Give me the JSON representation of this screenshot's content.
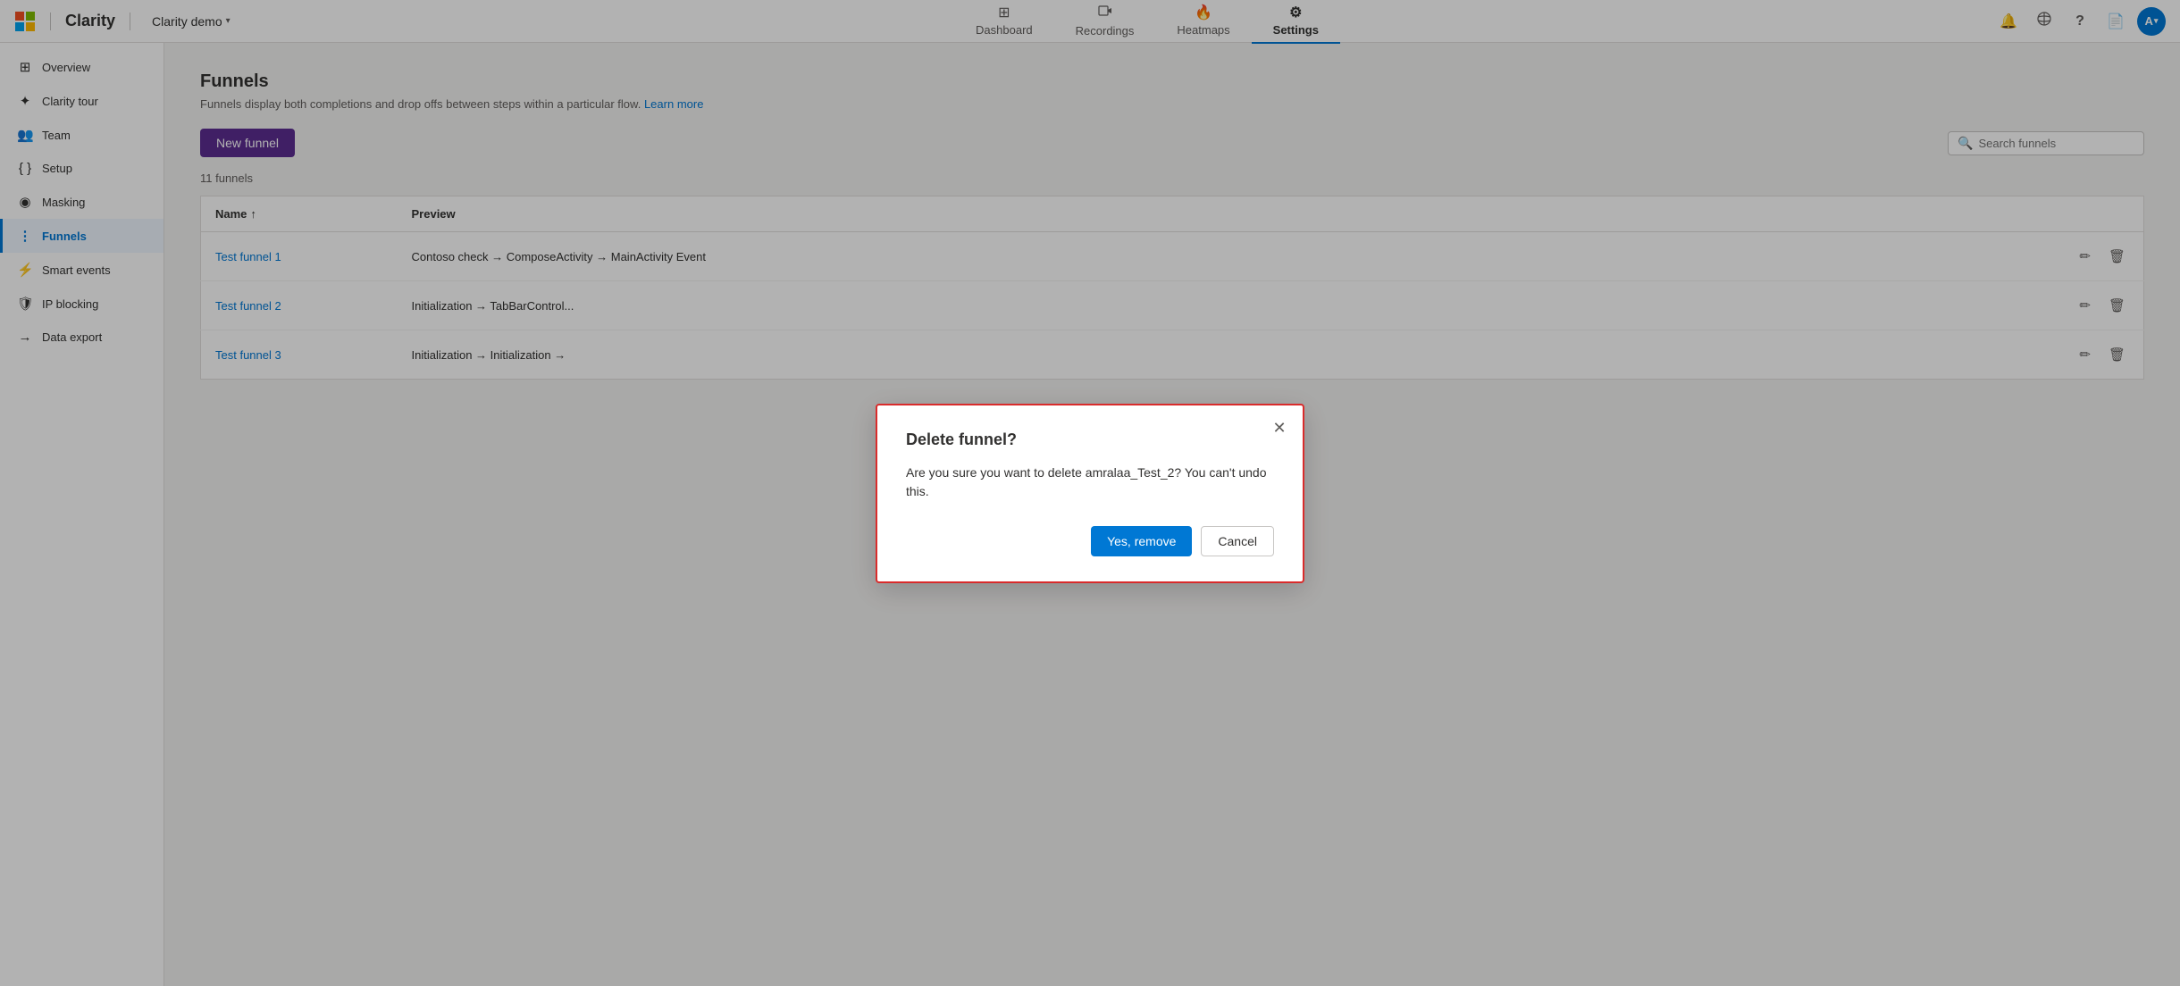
{
  "app": {
    "ms_logo_label": "Microsoft",
    "app_name": "Clarity",
    "project_name": "Clarity demo",
    "nav_divider": "|"
  },
  "top_nav": {
    "items": [
      {
        "id": "dashboard",
        "label": "Dashboard",
        "icon": "⊞"
      },
      {
        "id": "recordings",
        "label": "Recordings",
        "icon": "▷"
      },
      {
        "id": "heatmaps",
        "label": "Heatmaps",
        "icon": "🔥"
      },
      {
        "id": "settings",
        "label": "Settings",
        "icon": "⚙"
      }
    ],
    "active": "settings"
  },
  "top_nav_right": {
    "notification_icon": "🔔",
    "share_icon": "👤",
    "help_icon": "?",
    "docs_icon": "📄",
    "avatar_initials": "A"
  },
  "sidebar": {
    "items": [
      {
        "id": "overview",
        "label": "Overview",
        "icon": "⊞"
      },
      {
        "id": "clarity-tour",
        "label": "Clarity tour",
        "icon": "✦"
      },
      {
        "id": "team",
        "label": "Team",
        "icon": "👥"
      },
      {
        "id": "setup",
        "label": "Setup",
        "icon": "{}"
      },
      {
        "id": "masking",
        "label": "Masking",
        "icon": "◉"
      },
      {
        "id": "funnels",
        "label": "Funnels",
        "icon": "⋮"
      },
      {
        "id": "smart-events",
        "label": "Smart events",
        "icon": "⚡"
      },
      {
        "id": "ip-blocking",
        "label": "IP blocking",
        "icon": "🛡"
      },
      {
        "id": "data-export",
        "label": "Data export",
        "icon": "→"
      }
    ],
    "active": "funnels"
  },
  "main": {
    "page_title": "Funnels",
    "page_desc": "Funnels display both completions and drop offs between steps within a particular flow.",
    "learn_more_label": "Learn more",
    "new_funnel_label": "New funnel",
    "search_placeholder": "Search funnels",
    "funnels_count": "11 funnels",
    "table": {
      "col_name": "Name",
      "col_preview": "Preview",
      "sort_icon": "↑",
      "rows": [
        {
          "id": "funnel-1",
          "name": "Test funnel 1",
          "preview": "Contoso check → ComposeActivity → MainActivity Event"
        },
        {
          "id": "funnel-2",
          "name": "Test funnel 2",
          "preview": "Initialization → TabBarControl..."
        },
        {
          "id": "funnel-3",
          "name": "Test funnel 3",
          "preview": "Initialization → Initialization →"
        }
      ]
    }
  },
  "dialog": {
    "title": "Delete funnel?",
    "body": "Are you sure you want to delete amralaa_Test_2? You can't undo this.",
    "confirm_label": "Yes, remove",
    "cancel_label": "Cancel",
    "close_icon": "✕"
  }
}
